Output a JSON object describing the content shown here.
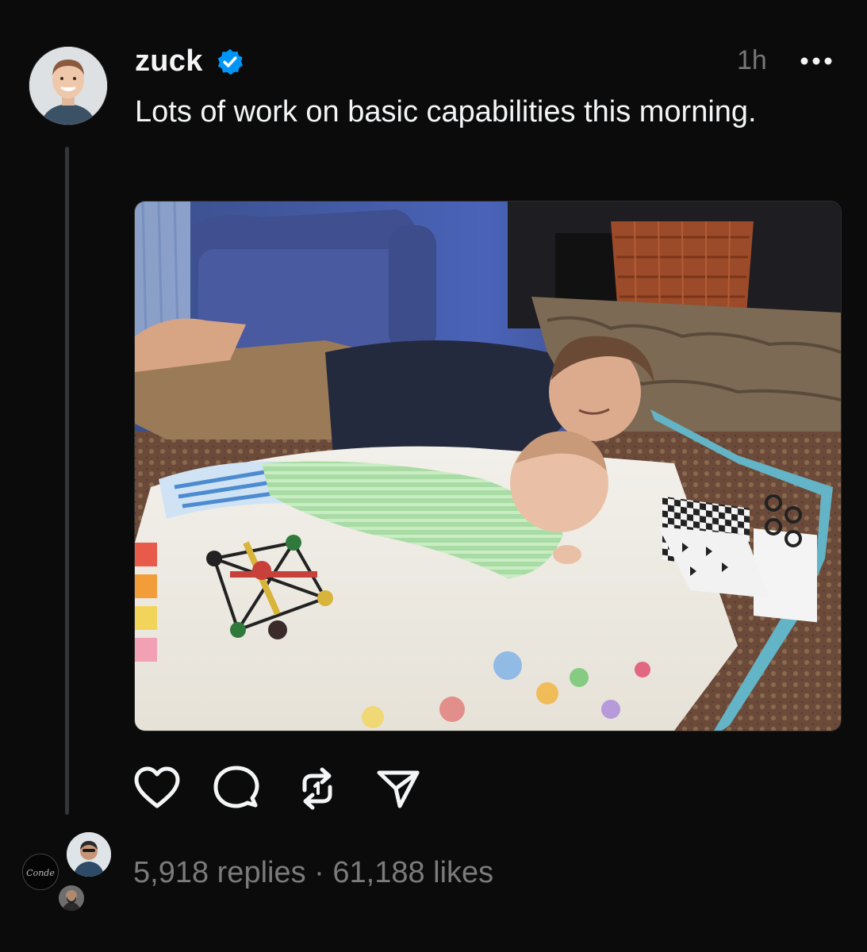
{
  "post": {
    "username": "zuck",
    "verified": true,
    "time_ago": "1h",
    "text": "Lots of work on basic capabilities this morning.",
    "stats": {
      "replies": "5,918 replies",
      "separator": "·",
      "likes": "61,188 likes"
    },
    "reply_avatar_watermark": "Conde"
  },
  "icons": {
    "verified": "verified-badge-icon",
    "more": "more-horizontal-icon",
    "like": "heart-icon",
    "reply": "comment-icon",
    "repost": "repost-icon",
    "share": "send-icon"
  },
  "colors": {
    "background": "#0b0b0b",
    "text_primary": "#f3f5f7",
    "text_secondary": "#7b7b7b",
    "verified_blue": "#0095f6",
    "thread_line": "#333638"
  }
}
